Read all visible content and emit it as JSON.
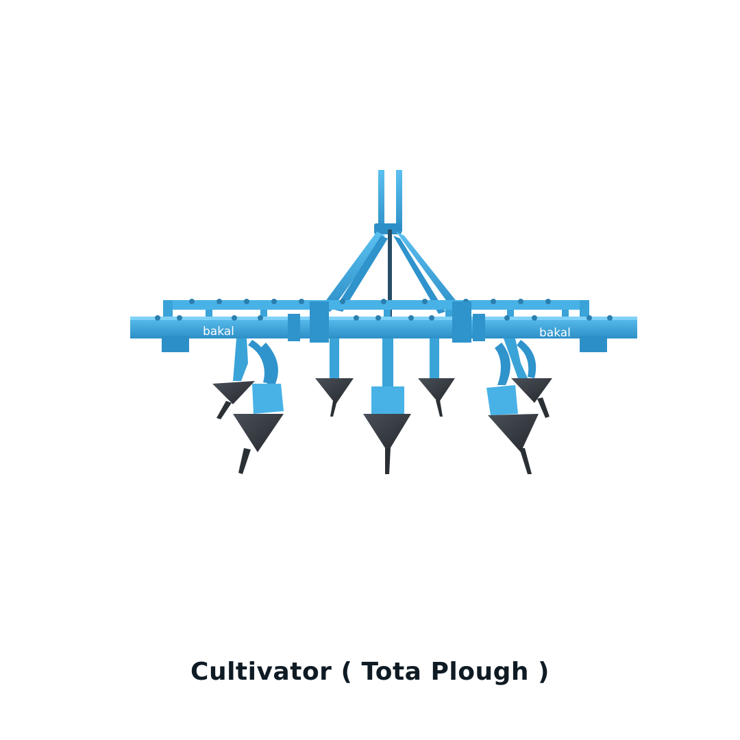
{
  "product": {
    "brand_marks": [
      "bakal",
      "bakal"
    ],
    "frame_color": "#3aa7e0",
    "blade_color": "#3a3f45"
  },
  "caption": {
    "title": "Cultivator ( Tota Plough )",
    "color": "#0f1b24"
  }
}
